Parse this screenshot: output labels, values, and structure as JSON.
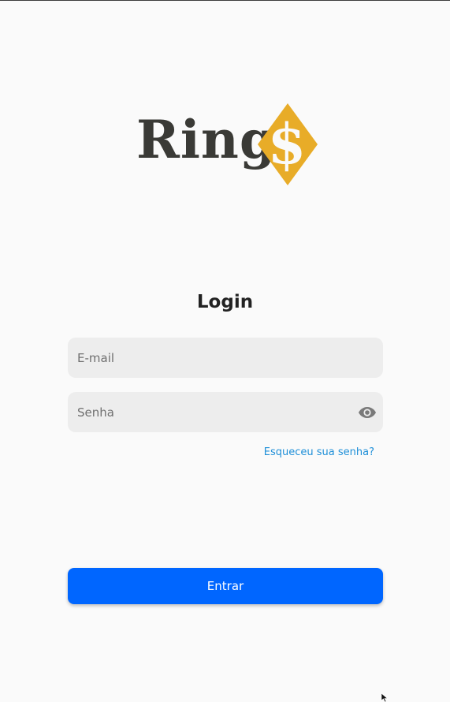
{
  "logo": {
    "text": "Ring",
    "symbol": "$",
    "icon": "dollar-diamond-icon",
    "text_color": "#3a3a36",
    "accent_color": "#e8ac28"
  },
  "login": {
    "title": "Login",
    "email_placeholder": "E-mail",
    "email_value": "",
    "password_placeholder": "Senha",
    "password_value": "",
    "password_toggle_icon": "eye-icon",
    "forgot_password_label": "Esqueceu sua senha?",
    "submit_label": "Entrar"
  },
  "colors": {
    "primary": "#0066ff",
    "link": "#1e8fd8",
    "field_bg": "#ededed",
    "page_bg": "#fafafa"
  }
}
